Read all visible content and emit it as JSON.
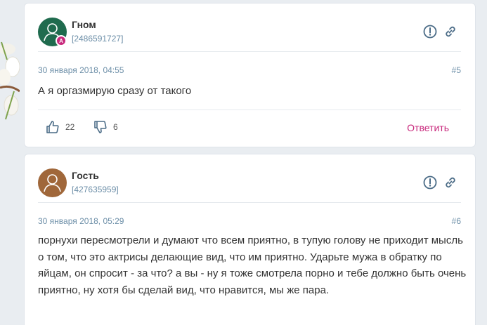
{
  "comments": [
    {
      "author": "Гном",
      "user_id": "[2486591727]",
      "badge": "A",
      "avatar_color": "#1f6b4e",
      "date": "30 января 2018, 04:55",
      "number": "#5",
      "text": "А я оргазмирую сразу от такого",
      "likes": "22",
      "dislikes": "6",
      "reply_label": "Ответить"
    },
    {
      "author": "Гость",
      "user_id": "[427635959]",
      "avatar_color": "#a0673a",
      "date": "30 января 2018, 05:29",
      "number": "#6",
      "text": "порнухи пересмотрели и думают что всем приятно, в тупую голову не приходит мысль о том, что это актрисы делающие вид, что им приятно. Ударьте мужа в обратку по яйцам, он спросит - за что? а вы - ну я тоже смотрела порно и тебе должно быть очень приятно, ну хотя бы сделай вид, что нравится, мы же пара."
    }
  ],
  "colors": {
    "accent": "#c8287c",
    "meta": "#6d8fa8",
    "icon": "#4a6b86"
  },
  "icons": [
    "report-icon",
    "link-icon",
    "thumbs-up-icon",
    "thumbs-down-icon",
    "person-icon"
  ]
}
